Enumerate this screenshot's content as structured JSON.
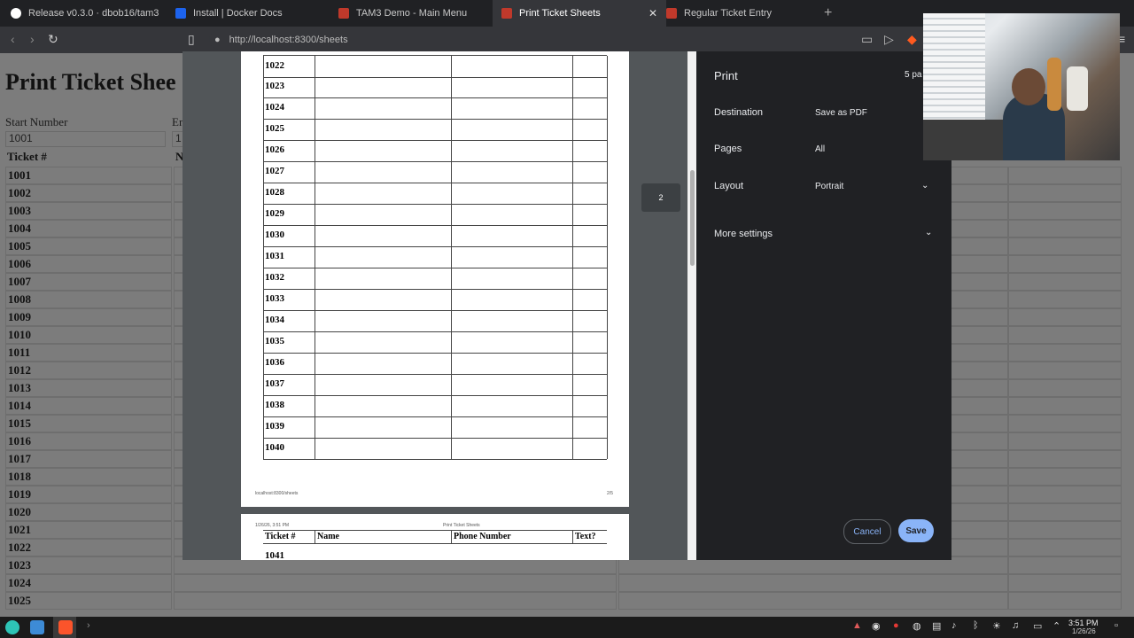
{
  "tabs": [
    {
      "title": "Release v0.3.0 · dbob16/tam3",
      "icon": "github-icon",
      "icon_color": "#ffffff"
    },
    {
      "title": "Install | Docker Docs",
      "icon": "docker-icon",
      "icon_color": "#1d63ed"
    },
    {
      "title": "TAM3 Demo - Main Menu",
      "icon": "tam3-icon",
      "icon_color": "#c0392b"
    },
    {
      "title": "Print Ticket Sheets",
      "icon": "tam3-icon",
      "icon_color": "#c0392b",
      "active": true
    },
    {
      "title": "Regular Ticket Entry",
      "icon": "tam3-icon",
      "icon_color": "#c0392b"
    }
  ],
  "new_tab": "+",
  "address": "http://localhost:8300/sheets",
  "page": {
    "title": "Print Ticket Shee",
    "start_label": "Start Number",
    "end_label": "En",
    "start_value": "1001",
    "end_value": "1",
    "header_ticket": "Ticket #",
    "header_name": "N",
    "tickets": [
      "1001",
      "1002",
      "1003",
      "1004",
      "1005",
      "1006",
      "1007",
      "1008",
      "1009",
      "1010",
      "1011",
      "1012",
      "1013",
      "1014",
      "1015",
      "1016",
      "1017",
      "1018",
      "1019",
      "1020",
      "1021",
      "1022",
      "1023",
      "1024",
      "1025"
    ]
  },
  "preview": {
    "rows": [
      "1022",
      "1023",
      "1024",
      "1025",
      "1026",
      "1027",
      "1028",
      "1029",
      "1030",
      "1031",
      "1032",
      "1033",
      "1034",
      "1035",
      "1036",
      "1037",
      "1038",
      "1039",
      "1040"
    ],
    "footer_url": "localhost:8300/sheets",
    "footer_page": "2/5",
    "page2_date": "1/26/26, 3:51 PM",
    "page2_title": "Print Ticket Sheets",
    "headers": [
      "Ticket #",
      "Name",
      "Phone Number",
      "Text?"
    ],
    "page2_first_row": "1041",
    "page_badge": "2"
  },
  "print_panel": {
    "title": "Print",
    "pages_count": "5 pa",
    "destination_label": "Destination",
    "destination_value": "Save as PDF",
    "pages_label": "Pages",
    "pages_value": "All",
    "layout_label": "Layout",
    "layout_value": "Portrait",
    "more_settings": "More settings",
    "cancel": "Cancel",
    "save": "Save"
  },
  "taskbar": {
    "time": "3:51 PM",
    "date": "1/26/26"
  }
}
